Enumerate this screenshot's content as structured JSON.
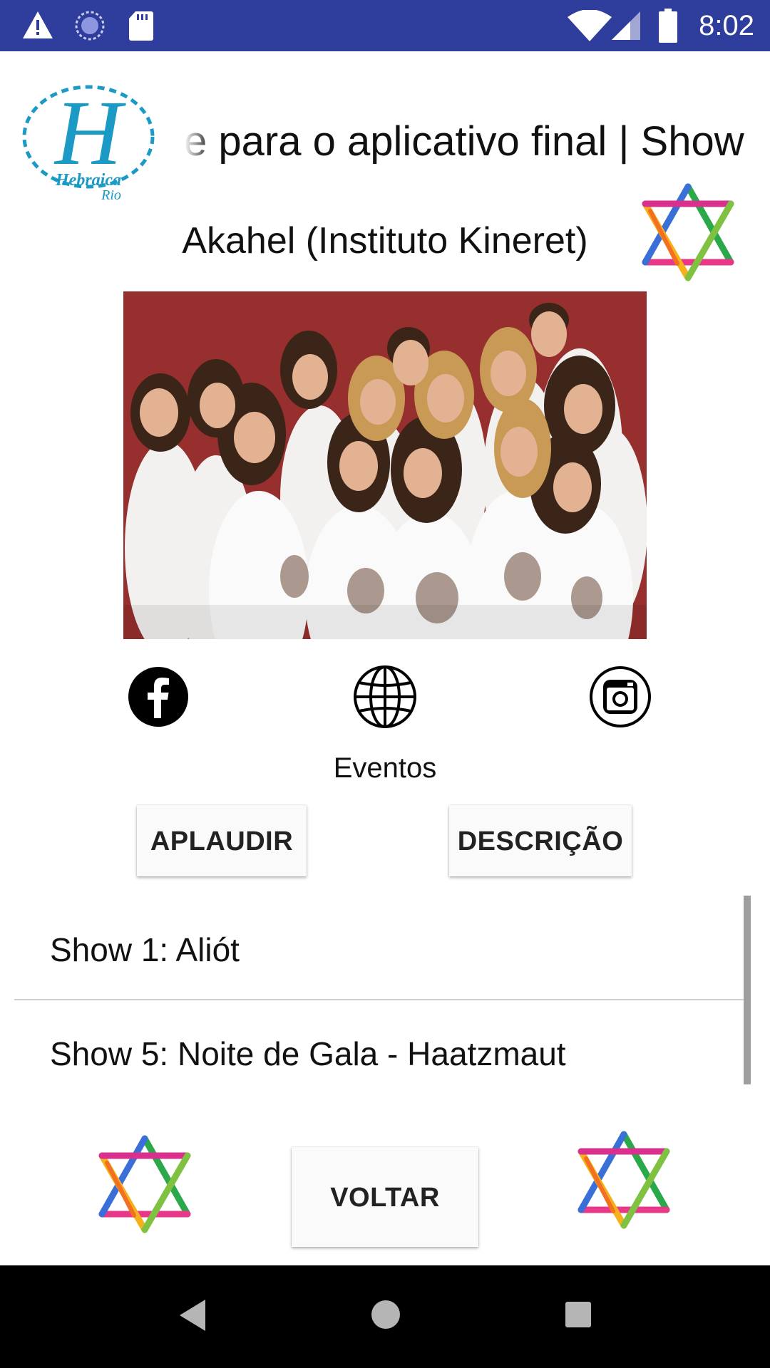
{
  "status_bar": {
    "time": "8:02",
    "icons": [
      "warning-icon",
      "sync-icon",
      "sd-card-icon",
      "wifi-icon",
      "signal-icon",
      "battery-icon"
    ]
  },
  "header": {
    "logo_text_main": "H",
    "logo_text_brand": "Hebraica",
    "logo_text_city": "Rio",
    "marquee_text": "e para o aplicativo final | Show",
    "title": "Akahel (Instituto Kineret)"
  },
  "social": {
    "website_label": "Eventos"
  },
  "buttons": {
    "aplaudir": "APLAUDIR",
    "descricao": "DESCRIÇÃO",
    "voltar": "VOLTAR"
  },
  "shows": [
    {
      "label": "Show 1: Aliót"
    },
    {
      "label": "Show 5: Noite de Gala - Haatzmaut"
    }
  ],
  "colors": {
    "status_bar": "#2f3d9c",
    "logo": "#1a9ac4",
    "photo_background": "#8f2a29",
    "nav_bar": "#000000"
  }
}
